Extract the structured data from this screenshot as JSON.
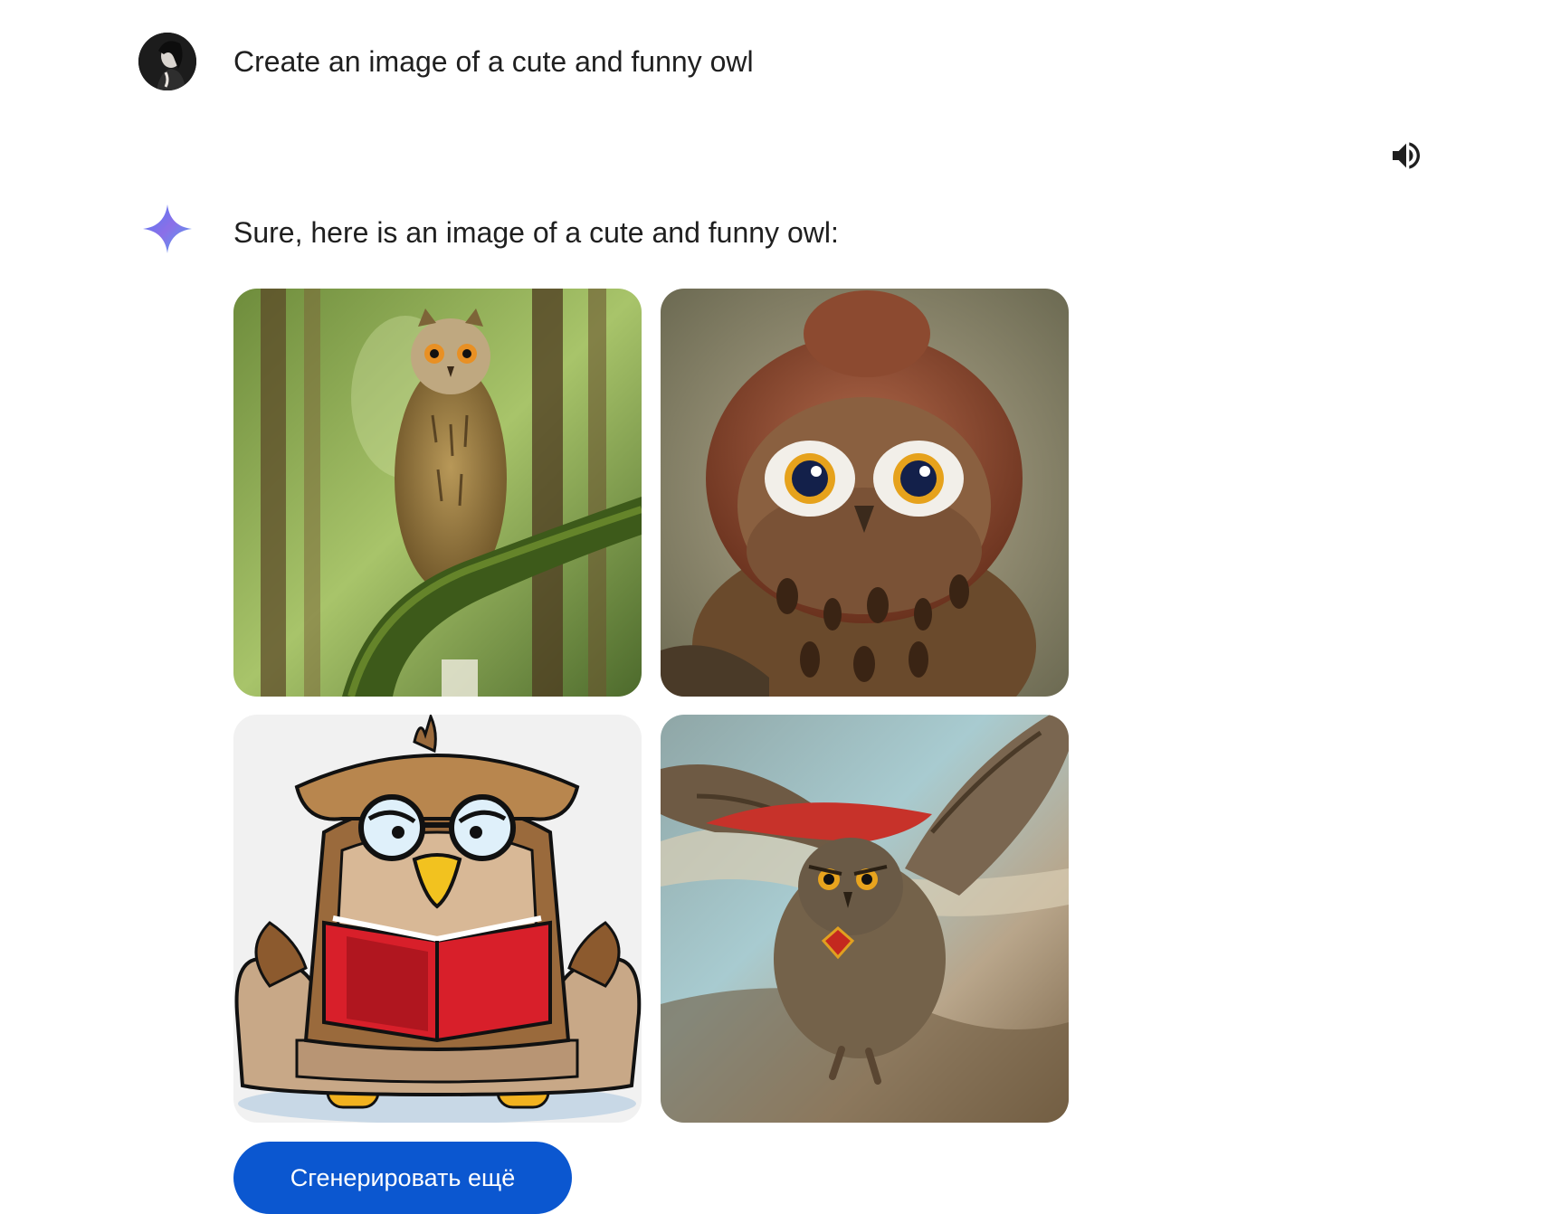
{
  "conversation": {
    "user": {
      "avatar_icon": "user-avatar-photo",
      "prompt": "Create an image of a cute and funny owl"
    },
    "reply": {
      "speaker_icon": "volume-up-icon",
      "assistant_icon": "gemini-sparkle-icon",
      "text": "Sure, here is an image of a cute and funny owl:",
      "images": [
        {
          "id": 1,
          "subject": "photo-owl-on-mossy-branch"
        },
        {
          "id": 2,
          "subject": "owl-wearing-brown-hat"
        },
        {
          "id": 3,
          "subject": "cartoon-owl-reading-book-in-armchair"
        },
        {
          "id": 4,
          "subject": "painted-owl-flying-with-red-cape"
        }
      ],
      "generate_more_label": "Сгенерировать ещё"
    }
  },
  "colors": {
    "button_bg": "#0b57d0",
    "button_text": "#ffffff",
    "text": "#1f1f1f"
  }
}
